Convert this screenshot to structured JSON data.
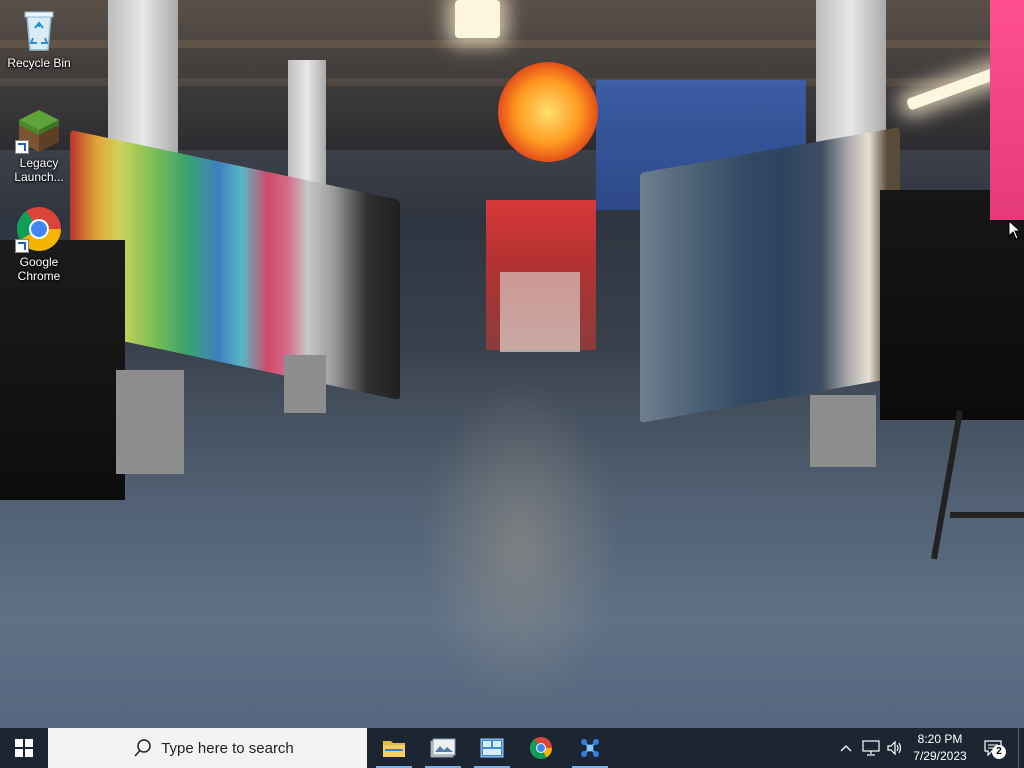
{
  "desktop": {
    "icons": [
      {
        "label": "Recycle Bin",
        "icon": "recycle-bin-icon"
      },
      {
        "label": "Legacy Launch...",
        "icon": "minecraft-grass-block-icon"
      },
      {
        "label": "Google Chrome",
        "icon": "chrome-icon"
      }
    ]
  },
  "taskbar": {
    "start_icon": "windows-logo-icon",
    "search_placeholder": "Type here to search",
    "apps": [
      {
        "name": "File Explorer",
        "icon": "file-explorer-icon"
      },
      {
        "name": "Photo app",
        "icon": "photo-app-icon"
      },
      {
        "name": "Control panel",
        "icon": "control-panel-icon"
      },
      {
        "name": "Google Chrome",
        "icon": "chrome-icon"
      },
      {
        "name": "App",
        "icon": "molecule-app-icon"
      }
    ],
    "tray": {
      "time": "8:20 PM",
      "date": "7/29/2023",
      "notification_count": "2"
    }
  },
  "colors": {
    "taskbar_bg": "#1c2633",
    "search_bg": "#f3f3f3",
    "active_indicator": "#7fb1e6"
  }
}
